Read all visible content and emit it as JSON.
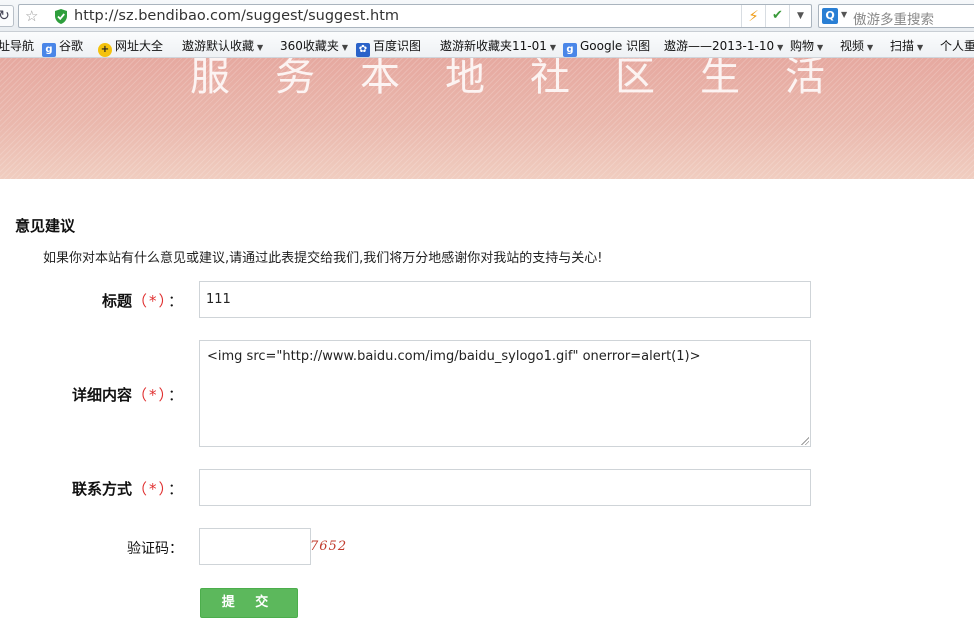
{
  "browser": {
    "url": "http://sz.bendibao.com/suggest/suggest.htm",
    "search_placeholder": "傲游多重搜索"
  },
  "bookmarks": [
    {
      "label": "址导航",
      "icon": "",
      "has_menu": false
    },
    {
      "label": "谷歌",
      "icon": "google-icon",
      "has_menu": false
    },
    {
      "label": "网址大全",
      "icon": "web-directory-icon",
      "has_menu": false
    },
    {
      "label": "遨游默认收藏",
      "icon": "",
      "has_menu": true
    },
    {
      "label": "360收藏夹",
      "icon": "",
      "has_menu": true
    },
    {
      "label": "百度识图",
      "icon": "baidu-paw-icon",
      "has_menu": false
    },
    {
      "label": "遨游新收藏夹11-01",
      "icon": "",
      "has_menu": true
    },
    {
      "label": "Google 识图",
      "icon": "google-icon",
      "has_menu": false
    },
    {
      "label": "遨游——2013-1-10",
      "icon": "",
      "has_menu": true
    },
    {
      "label": "购物",
      "icon": "",
      "has_menu": true
    },
    {
      "label": "视频",
      "icon": "",
      "has_menu": true
    },
    {
      "label": "扫描",
      "icon": "",
      "has_menu": true
    },
    {
      "label": "个人重",
      "icon": "",
      "has_menu": false
    }
  ],
  "banner": {
    "slogan": "服务本地社区生活"
  },
  "form": {
    "section_title": "意见建议",
    "intro": "如果你对本站有什么意见或建议,请通过此表提交给我们,我们将万分地感谢你对我站的支持与关心!",
    "required_mark": "（*）",
    "colon": "：",
    "title_label": "标题",
    "title_value": "111",
    "detail_label": "详细内容",
    "detail_value": "<img src=\"http://www.baidu.com/img/baidu_sylogo1.gif\" onerror=alert(1)>",
    "contact_label": "联系方式",
    "contact_value": "",
    "captcha_label": "验证码：",
    "captcha_value": "",
    "captcha_text": "7652",
    "submit_label": "提 交"
  }
}
